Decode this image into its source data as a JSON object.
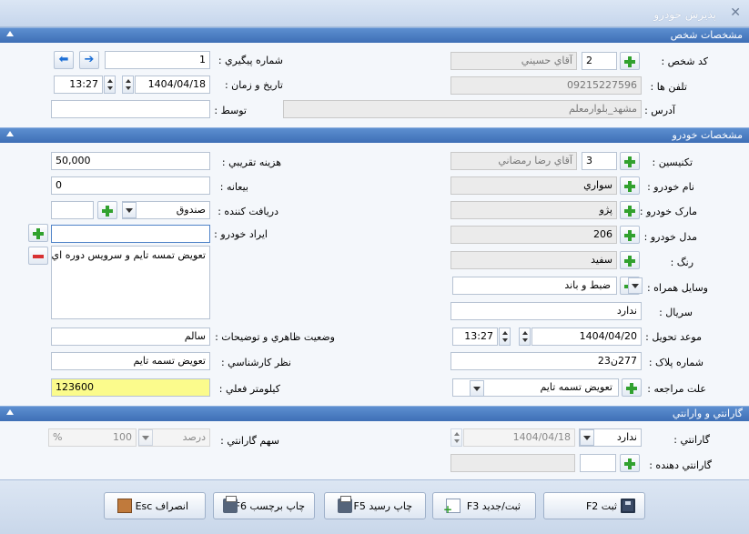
{
  "window": {
    "title": "پذيرش خودرو"
  },
  "sections": {
    "person": "مشخصات شخص",
    "vehicle": "مشخصات خودرو",
    "warranty": "گارانتي و وارانتي"
  },
  "person": {
    "code_label": "کد شخص :",
    "code_value": "2",
    "name_value": "آقاي  حسيني",
    "phone_label": "تلفن ها :",
    "phone_value": "09215227596",
    "address_label": "آدرس :",
    "address_value": "مشهد_بلوارمعلم",
    "tracking_label": "شماره پيگيري :",
    "tracking_value": "1",
    "datetime_label": "تاريخ و زمان :",
    "date_value": "1404/04/18",
    "time_value": "13:27",
    "by_label": "توسط :",
    "by_value": ""
  },
  "vehicle": {
    "technician_label": "تکنيسين :",
    "technician_code": "3",
    "technician_name": "آقاي رضا رمضاني",
    "car_name_label": "نام خودرو :",
    "car_name_value": "سواري",
    "brand_label": "مارک خودرو :",
    "brand_value": "پژو",
    "model_label": "مدل خودرو :",
    "model_value": "206",
    "color_label": "رنگ :",
    "color_value": "سفيد",
    "accessories_label": "وسايل همراه :",
    "accessories_value": "ضبط و باند",
    "serial_label": "سريال :",
    "serial_value": "ندارد",
    "delivery_label": "موعد تحويل :",
    "delivery_date": "1404/04/20",
    "delivery_time": "13:27",
    "plate_label": "شماره پلاک :",
    "plate_value": "277ن23",
    "reason_label": "علت مراجعه :",
    "reason_value": "تعويض تسمه تايم",
    "cost_label": "هزينه تقريبي :",
    "cost_value": "50,000",
    "deposit_label": "بيعانه :",
    "deposit_value": "0",
    "receiver_label": "دريافت کننده :",
    "receiver_value": "صندوق",
    "defects_label": "ايراد خودرو :",
    "defects_input": "",
    "defects_list": "تعويض تمسه تايم و سرويس دوره اي",
    "appearance_label": "وضعيت ظاهري و توضيحات :",
    "appearance_value": "سالم",
    "expert_label": "نظر کارشناسي :",
    "expert_value": "تعويض تسمه تايم",
    "km_label": "کيلومتر فعلي :",
    "km_value": "123600"
  },
  "warranty": {
    "warranty_label": "گارانتي :",
    "warranty_value": "ندارد",
    "warranty_date": "1404/04/18",
    "share_label": "سهم گارانتي :",
    "share_type": "درصد",
    "share_value": "100",
    "share_unit": "%",
    "giver_label": "گارانتي دهنده :",
    "giver_code": "",
    "giver_name": ""
  },
  "buttons": {
    "save": "ثبت F2",
    "save_new": "ثبت/جديد F3",
    "print_receipt": "چاپ رسيد F5",
    "print_label": "چاپ برچسب F6",
    "cancel": "انصراف Esc"
  }
}
